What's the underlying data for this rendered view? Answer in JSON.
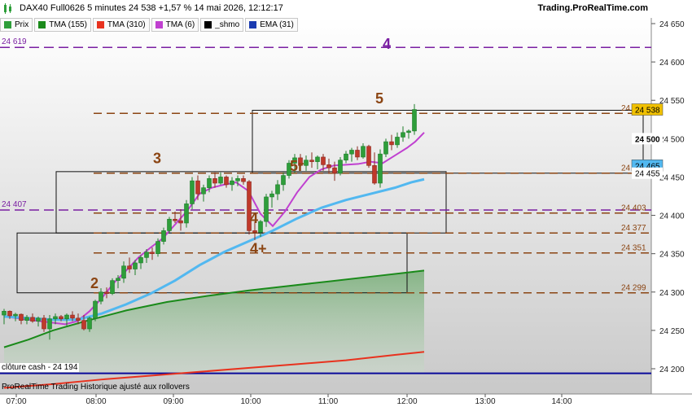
{
  "header": {
    "title": "DAX40 Full0626 5 minutes 24 538 +1,57 % 14 mai 2026, 12:12:17",
    "brand": "Trading.ProRealTime.com"
  },
  "legend": [
    {
      "label": "Prix",
      "color": "#2e9e3a",
      "icon": "candlestick-icon"
    },
    {
      "label": "TMA (155)",
      "color": "#1a8a1a"
    },
    {
      "label": "TMA (310)",
      "color": "#e8321e"
    },
    {
      "label": "TMA (6)",
      "color": "#c040d0"
    },
    {
      "label": "_shmo",
      "color": "#000000"
    },
    {
      "label": "EMA (31)",
      "color": "#1a3ab0"
    }
  ],
  "footer": {
    "text": "ProRealTime Trading  Historique ajusté aux rollovers",
    "cash_label": "clôture cash -  24 194"
  },
  "chart_data": {
    "type": "candlestick",
    "xlabel": "",
    "ylabel": "",
    "ylim": [
      24182,
      24660
    ],
    "x_ticks": [
      "07:00",
      "08:00",
      "09:00",
      "10:00",
      "11:00",
      "12:00",
      "13:00",
      "14:00"
    ],
    "y_ticks": [
      24200,
      24250,
      24300,
      24350,
      24400,
      24450,
      24500,
      24550,
      24600,
      24650
    ],
    "last_price": "24 538",
    "ohlc": [
      [
        24270,
        24278,
        24258,
        24275
      ],
      [
        24275,
        24276,
        24265,
        24269
      ],
      [
        24269,
        24273,
        24262,
        24271
      ],
      [
        24271,
        24272,
        24258,
        24263
      ],
      [
        24263,
        24270,
        24258,
        24267
      ],
      [
        24267,
        24272,
        24260,
        24262
      ],
      [
        24262,
        24268,
        24255,
        24266
      ],
      [
        24266,
        24270,
        24248,
        24252
      ],
      [
        24252,
        24270,
        24238,
        24265
      ],
      [
        24265,
        24272,
        24258,
        24268
      ],
      [
        24268,
        24270,
        24262,
        24265
      ],
      [
        24265,
        24272,
        24256,
        24270
      ],
      [
        24270,
        24275,
        24262,
        24266
      ],
      [
        24266,
        24272,
        24258,
        24263
      ],
      [
        24263,
        24270,
        24250,
        24252
      ],
      [
        24252,
        24268,
        24248,
        24266
      ],
      [
        24266,
        24290,
        24262,
        24288
      ],
      [
        24288,
        24305,
        24284,
        24300
      ],
      [
        24300,
        24306,
        24292,
        24298
      ],
      [
        24298,
        24318,
        24296,
        24315
      ],
      [
        24315,
        24322,
        24305,
        24318
      ],
      [
        24318,
        24340,
        24312,
        24334
      ],
      [
        24334,
        24345,
        24325,
        24330
      ],
      [
        24330,
        24342,
        24322,
        24338
      ],
      [
        24338,
        24348,
        24330,
        24345
      ],
      [
        24345,
        24356,
        24338,
        24352
      ],
      [
        24352,
        24358,
        24342,
        24350
      ],
      [
        24350,
        24370,
        24346,
        24366
      ],
      [
        24366,
        24384,
        24362,
        24380
      ],
      [
        24380,
        24398,
        24376,
        24395
      ],
      [
        24395,
        24405,
        24390,
        24393
      ],
      [
        24393,
        24408,
        24380,
        24390
      ],
      [
        24390,
        24420,
        24384,
        24415
      ],
      [
        24415,
        24450,
        24408,
        24445
      ],
      [
        24445,
        24452,
        24420,
        24428
      ],
      [
        24428,
        24440,
        24418,
        24436
      ],
      [
        24436,
        24452,
        24430,
        24448
      ],
      [
        24448,
        24456,
        24436,
        24442
      ],
      [
        24442,
        24456,
        24440,
        24450
      ],
      [
        24450,
        24452,
        24436,
        24440
      ],
      [
        24440,
        24450,
        24432,
        24445
      ],
      [
        24445,
        24452,
        24438,
        24448
      ],
      [
        24448,
        24452,
        24440,
        24444
      ],
      [
        24444,
        24446,
        24375,
        24380
      ],
      [
        24380,
        24392,
        24368,
        24378
      ],
      [
        24378,
        24394,
        24372,
        24392
      ],
      [
        24392,
        24428,
        24385,
        24424
      ],
      [
        24424,
        24432,
        24410,
        24428
      ],
      [
        24428,
        24446,
        24420,
        24440
      ],
      [
        24440,
        24456,
        24432,
        24452
      ],
      [
        24452,
        24472,
        24448,
        24468
      ],
      [
        24468,
        24480,
        24455,
        24475
      ],
      [
        24475,
        24480,
        24460,
        24465
      ],
      [
        24465,
        24478,
        24458,
        24472
      ],
      [
        24472,
        24482,
        24462,
        24470
      ],
      [
        24470,
        24478,
        24460,
        24476
      ],
      [
        24476,
        24480,
        24458,
        24466
      ],
      [
        24466,
        24474,
        24455,
        24462
      ],
      [
        24462,
        24470,
        24445,
        24455
      ],
      [
        24455,
        24476,
        24452,
        24472
      ],
      [
        24472,
        24484,
        24468,
        24480
      ],
      [
        24480,
        24488,
        24470,
        24485
      ],
      [
        24485,
        24490,
        24472,
        24476
      ],
      [
        24476,
        24494,
        24474,
        24490
      ],
      [
        24490,
        24492,
        24462,
        24465
      ],
      [
        24465,
        24482,
        24440,
        24442
      ],
      [
        24442,
        24486,
        24436,
        24480
      ],
      [
        24480,
        24500,
        24476,
        24496
      ],
      [
        24496,
        24505,
        24485,
        24492
      ],
      [
        24492,
        24508,
        24488,
        24502
      ],
      [
        24502,
        24516,
        24496,
        24508
      ],
      [
        24508,
        24512,
        24500,
        24510
      ],
      [
        24510,
        24545,
        24505,
        24538
      ]
    ],
    "series": [
      {
        "name": "TMA (155)",
        "color": "#1a8a1a",
        "values": [
          [
            0,
            24228
          ],
          [
            30,
            24238
          ],
          [
            60,
            24250
          ],
          [
            100,
            24262
          ],
          [
            150,
            24276
          ],
          [
            200,
            24287
          ],
          [
            250,
            24295
          ],
          [
            300,
            24302
          ],
          [
            350,
            24308
          ],
          [
            400,
            24314
          ],
          [
            450,
            24320
          ],
          [
            500,
            24326
          ],
          [
            516,
            24328
          ]
        ]
      },
      {
        "name": "TMA (310)",
        "color": "#e8321e",
        "values": [
          [
            0,
            24175
          ],
          [
            60,
            24180
          ],
          [
            120,
            24186
          ],
          [
            180,
            24191
          ],
          [
            240,
            24196
          ],
          [
            300,
            24201
          ],
          [
            360,
            24206
          ],
          [
            420,
            24211
          ],
          [
            480,
            24218
          ],
          [
            516,
            24222
          ]
        ]
      },
      {
        "name": "TMA (6)",
        "color": "#c040d0",
        "values": [
          [
            0,
            24268
          ],
          [
            15,
            24266
          ],
          [
            30,
            24264
          ],
          [
            45,
            24262
          ],
          [
            60,
            24260
          ],
          [
            75,
            24258
          ],
          [
            90,
            24262
          ],
          [
            105,
            24275
          ],
          [
            120,
            24292
          ],
          [
            135,
            24312
          ],
          [
            150,
            24328
          ],
          [
            165,
            24345
          ],
          [
            180,
            24358
          ],
          [
            195,
            24370
          ],
          [
            210,
            24388
          ],
          [
            225,
            24406
          ],
          [
            240,
            24428
          ],
          [
            255,
            24436
          ],
          [
            270,
            24440
          ],
          [
            285,
            24443
          ],
          [
            300,
            24432
          ],
          [
            315,
            24402
          ],
          [
            330,
            24386
          ],
          [
            345,
            24405
          ],
          [
            360,
            24430
          ],
          [
            375,
            24450
          ],
          [
            390,
            24460
          ],
          [
            405,
            24465
          ],
          [
            420,
            24466
          ],
          [
            435,
            24467
          ],
          [
            450,
            24470
          ],
          [
            465,
            24468
          ],
          [
            480,
            24478
          ],
          [
            495,
            24488
          ],
          [
            505,
            24496
          ],
          [
            516,
            24508
          ]
        ]
      },
      {
        "name": "_shmo",
        "color": "#000000",
        "values": []
      },
      {
        "name": "EMA (31)",
        "color": "#52b8f0",
        "values": [
          [
            0,
            24268
          ],
          [
            30,
            24266
          ],
          [
            60,
            24264
          ],
          [
            90,
            24264
          ],
          [
            120,
            24272
          ],
          [
            150,
            24284
          ],
          [
            180,
            24298
          ],
          [
            210,
            24315
          ],
          [
            240,
            24335
          ],
          [
            270,
            24352
          ],
          [
            300,
            24366
          ],
          [
            330,
            24380
          ],
          [
            360,
            24396
          ],
          [
            390,
            24410
          ],
          [
            420,
            24420
          ],
          [
            450,
            24428
          ],
          [
            480,
            24436
          ],
          [
            500,
            24443
          ],
          [
            516,
            24447
          ]
        ]
      }
    ],
    "hlines": [
      {
        "value": 24619,
        "label": "24 619",
        "color": "#7a1fa2",
        "style": "long-dash",
        "wave": "4"
      },
      {
        "value": 24533,
        "label": "24 533",
        "color": "#8b4513",
        "style": "dash"
      },
      {
        "value": 24455,
        "label": "24 455",
        "color": "#8b4513",
        "style": "dash"
      },
      {
        "value": 24407,
        "label": "24 407",
        "color": "#7a1fa2",
        "style": "long-dash"
      },
      {
        "value": 24403,
        "label": "24 403",
        "color": "#8b4513",
        "style": "dash"
      },
      {
        "value": 24377,
        "label": "24 377",
        "color": "#8b4513",
        "style": "dash"
      },
      {
        "value": 24351,
        "label": "24 351",
        "color": "#8b4513",
        "style": "dash"
      },
      {
        "value": 24299,
        "label": "24 299",
        "color": "#8b4513",
        "style": "dash"
      },
      {
        "value": 24194,
        "label": "",
        "color": "#0a0a9a",
        "style": "solid"
      }
    ],
    "price_tags": [
      {
        "value": 24538,
        "label": "24 538",
        "bg": "#f0c000"
      },
      {
        "value": 24500,
        "label": "24 500",
        "bg": "#ffffff",
        "bold": true
      },
      {
        "value": 24465,
        "label": "24 465",
        "bg": "#52b8f0"
      },
      {
        "value": 24455,
        "label": "24 455",
        "bg": "#ffffff"
      }
    ],
    "wave_labels": [
      {
        "text": "2",
        "bar": 16,
        "value": 24305
      },
      {
        "text": "3",
        "bar": 27,
        "value": 24468
      },
      {
        "text": "4",
        "bar": 44,
        "value": 24390
      },
      {
        "text": "4+",
        "bar": 44,
        "value": 24350
      },
      {
        "text": "5r",
        "bar": 51,
        "value": 24458
      },
      {
        "text": "5",
        "bar": 66,
        "value": 24546
      }
    ]
  }
}
